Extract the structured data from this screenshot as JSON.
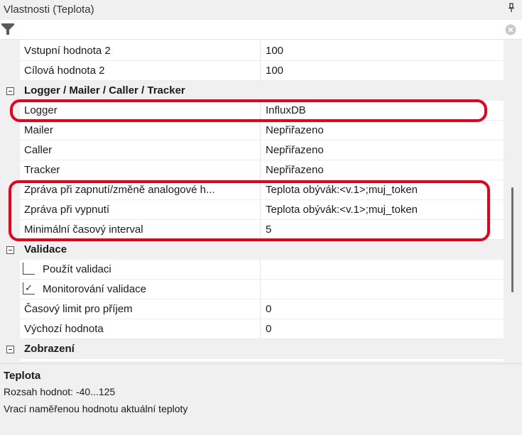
{
  "panel": {
    "title": "Vlastnosti (Teplota)",
    "pin_glyph": "⑁"
  },
  "filter": {
    "value": "",
    "icons": [
      "filter-icon",
      "clear-icon"
    ]
  },
  "rows": [
    {
      "type": "prop",
      "name": "Vstupní hodnota 2",
      "value": "100"
    },
    {
      "type": "prop",
      "name": "Cílová hodnota 2",
      "value": "100"
    },
    {
      "type": "category",
      "name": "Logger / Mailer / Caller / Tracker"
    },
    {
      "type": "prop",
      "name": "Logger",
      "value": "InfluxDB"
    },
    {
      "type": "prop",
      "name": "Mailer",
      "value": "Nepřiřazeno"
    },
    {
      "type": "prop",
      "name": "Caller",
      "value": "Nepřiřazeno"
    },
    {
      "type": "prop",
      "name": "Tracker",
      "value": "Nepřiřazeno"
    },
    {
      "type": "prop",
      "name": "Zpráva při zapnutí/změně analogové h...",
      "value": "Teplota obývák:<v.1>;muj_token"
    },
    {
      "type": "prop",
      "name": "Zpráva při vypnutí",
      "value": "Teplota obývák:<v.1>;muj_token"
    },
    {
      "type": "prop",
      "name": "Minimální časový interval",
      "value": "5"
    },
    {
      "type": "category",
      "name": "Validace"
    },
    {
      "type": "check",
      "name": "Použít validaci",
      "checked": false
    },
    {
      "type": "check",
      "name": "Monitorování validace",
      "checked": true
    },
    {
      "type": "prop",
      "name": "Časový limit pro příjem",
      "value": "0"
    },
    {
      "type": "prop",
      "name": "Výchozí hodnota",
      "value": "0"
    },
    {
      "type": "category",
      "name": "Zobrazení"
    }
  ],
  "highlight_color": "#e8001c",
  "description": {
    "title": "Teplota",
    "line1": "Rozsah hodnot: -40...125",
    "line2": "Vrací naměřenou hodnotu aktuální teploty"
  }
}
